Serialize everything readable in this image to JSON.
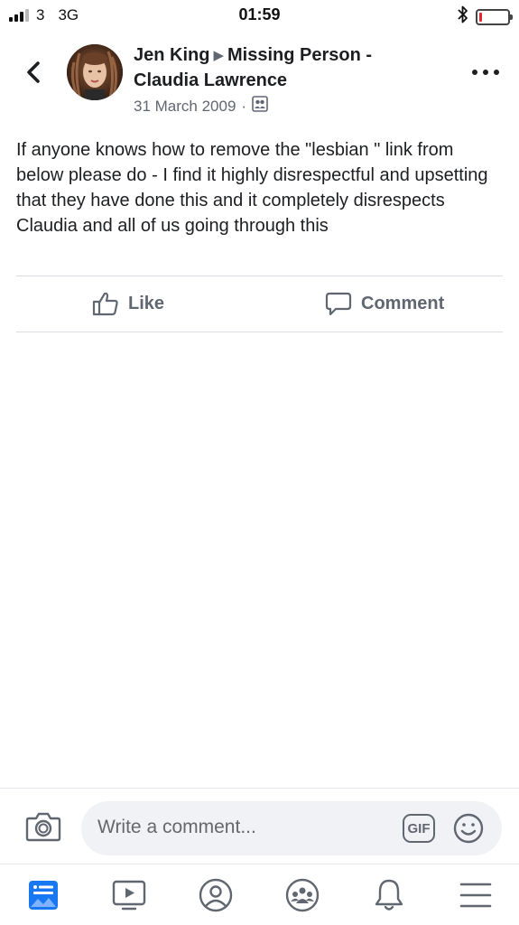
{
  "status_bar": {
    "carrier": "3",
    "network": "3G",
    "time": "01:59",
    "battery_color": "#e0282e",
    "battery_level": 0.1,
    "icons": [
      "signal-icon",
      "bluetooth-icon",
      "battery-icon"
    ]
  },
  "post": {
    "author": "Jen King",
    "group": "Missing Person - Claudia Lawrence",
    "date": "31 March 2009",
    "separator": "·",
    "privacy_icon": "group-audience-icon",
    "text": "If anyone knows how to remove the \"lesbian \" link from below please do - I find it highly disrespectful and upsetting that they have done this and it completely disrespects Claudia and all of us going through this"
  },
  "actions": {
    "like_label": "Like",
    "comment_label": "Comment"
  },
  "comment_bar": {
    "placeholder": "Write a comment...",
    "gif_label": "GIF"
  },
  "bottom_nav": {
    "items": [
      "news-feed-icon",
      "watch-icon",
      "profile-icon",
      "groups-icon",
      "notifications-icon",
      "menu-icon"
    ],
    "active_color": "#1877f2"
  }
}
